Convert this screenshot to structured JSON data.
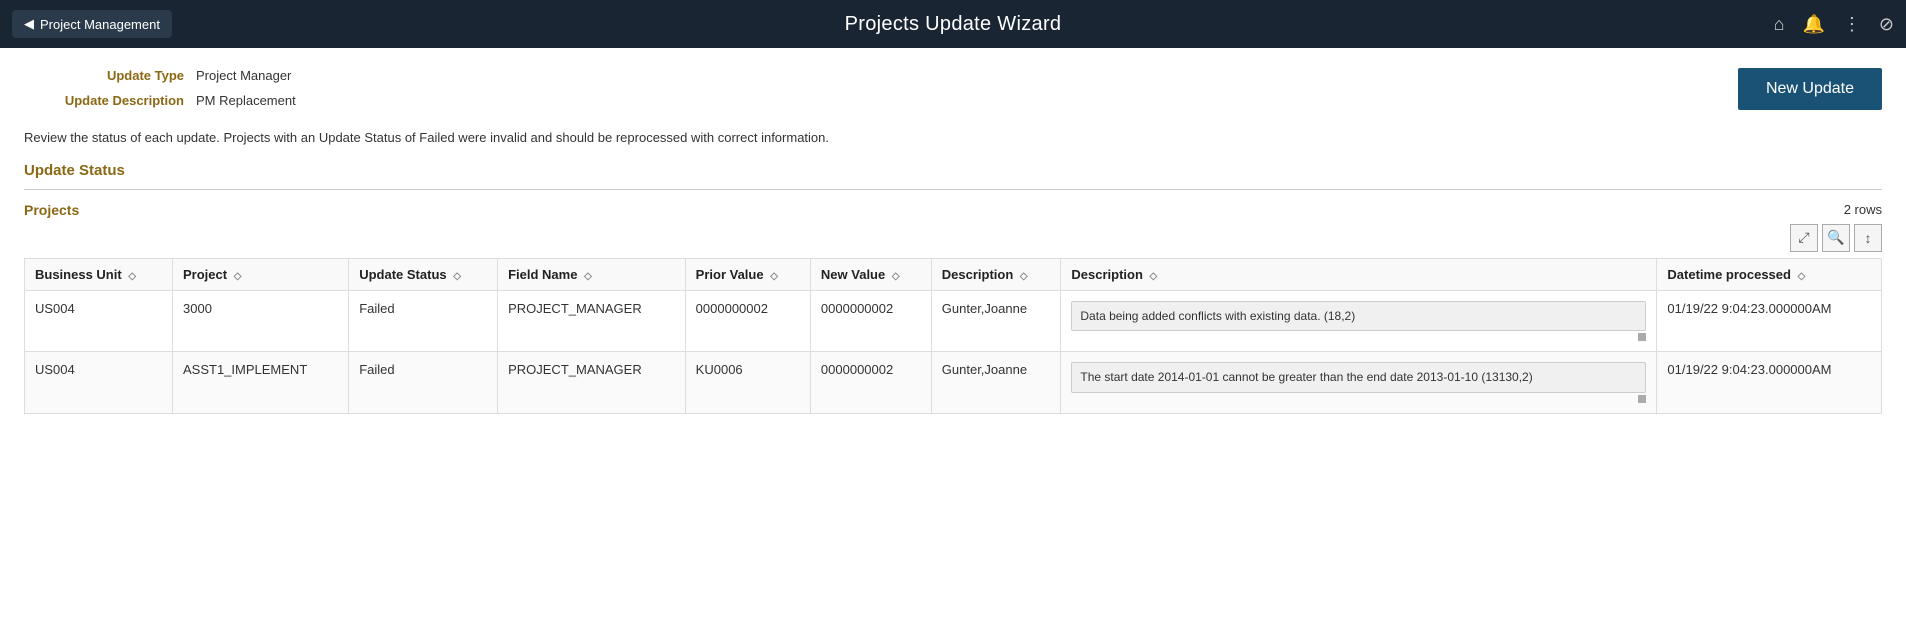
{
  "header": {
    "back_label": "Project Management",
    "title": "Projects Update Wizard",
    "back_icon": "◀",
    "home_icon": "⌂",
    "bell_icon": "🔔",
    "more_icon": "⋮",
    "disable_icon": "⊘"
  },
  "form": {
    "update_type_label": "Update Type",
    "update_type_value": "Project Manager",
    "update_description_label": "Update Description",
    "update_description_value": "PM Replacement"
  },
  "new_update_button": "New Update",
  "review_text": "Review the status of each update. Projects with an Update Status of Failed were invalid and should be reprocessed with correct information.",
  "update_status_title": "Update Status",
  "projects_title": "Projects",
  "rows_count": "2 rows",
  "toolbar": {
    "expand_icon": "⤢",
    "search_icon": "🔍",
    "sort_icon": "↕"
  },
  "table": {
    "columns": [
      {
        "label": "Business Unit",
        "sort": "◇"
      },
      {
        "label": "Project",
        "sort": "◇"
      },
      {
        "label": "Update Status",
        "sort": "◇"
      },
      {
        "label": "Field Name",
        "sort": "◇"
      },
      {
        "label": "Prior Value",
        "sort": "◇"
      },
      {
        "label": "New Value",
        "sort": "◇"
      },
      {
        "label": "Description",
        "sort": "◇"
      },
      {
        "label": "Description",
        "sort": "◇"
      },
      {
        "label": "Datetime processed",
        "sort": "◇"
      }
    ],
    "rows": [
      {
        "business_unit": "US004",
        "project": "3000",
        "update_status": "Failed",
        "field_name": "PROJECT_MANAGER",
        "prior_value": "0000000002",
        "new_value": "0000000002",
        "description_short": "Gunter,Joanne",
        "description_long": "Data being added conflicts with existing data. (18,2)",
        "datetime": "01/19/22  9:04:23.000000AM"
      },
      {
        "business_unit": "US004",
        "project": "ASST1_IMPLEMENT",
        "update_status": "Failed",
        "field_name": "PROJECT_MANAGER",
        "prior_value": "KU0006",
        "new_value": "0000000002",
        "description_short": "Gunter,Joanne",
        "description_long": "The start date 2014-01-01 cannot be greater than the end date 2013-01-10 (13130,2)",
        "datetime": "01/19/22  9:04:23.000000AM"
      }
    ]
  }
}
